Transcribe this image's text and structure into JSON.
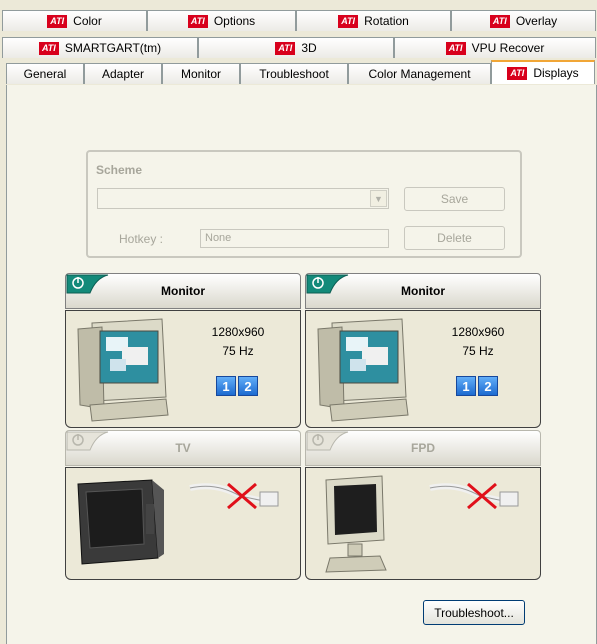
{
  "tabs": {
    "row1": [
      {
        "label": "Color",
        "ati": true
      },
      {
        "label": "Options",
        "ati": true
      },
      {
        "label": "Rotation",
        "ati": true
      },
      {
        "label": "Overlay",
        "ati": true
      }
    ],
    "row2": [
      {
        "label": "SMARTGART(tm)",
        "ati": true
      },
      {
        "label": "3D",
        "ati": true
      },
      {
        "label": "VPU Recover",
        "ati": true
      }
    ],
    "row3": [
      {
        "label": "General",
        "ati": false
      },
      {
        "label": "Adapter",
        "ati": false
      },
      {
        "label": "Monitor",
        "ati": false
      },
      {
        "label": "Troubleshoot",
        "ati": false
      },
      {
        "label": "Color Management",
        "ati": false
      },
      {
        "label": "Displays",
        "ati": true,
        "active": true
      }
    ],
    "ati_logo": "ATI"
  },
  "scheme": {
    "title": "Scheme",
    "save_label": "Save",
    "delete_label": "Delete",
    "hotkey_label": "Hotkey :",
    "hotkey_value": "None"
  },
  "devices": {
    "monitor1": {
      "name": "Monitor",
      "resolution": "1280x960",
      "refresh": "75 Hz",
      "badges": [
        "1",
        "2"
      ],
      "enabled": true
    },
    "monitor2": {
      "name": "Monitor",
      "resolution": "1280x960",
      "refresh": "75 Hz",
      "badges": [
        "1",
        "2"
      ],
      "enabled": true
    },
    "tv": {
      "name": "TV",
      "enabled": false
    },
    "fpd": {
      "name": "FPD",
      "enabled": false
    }
  },
  "troubleshoot_label": "Troubleshoot...",
  "colors": {
    "ati_red": "#d8001c",
    "badge_blue": "#1c6ad0",
    "panel_bg": "#f5f4ea"
  }
}
